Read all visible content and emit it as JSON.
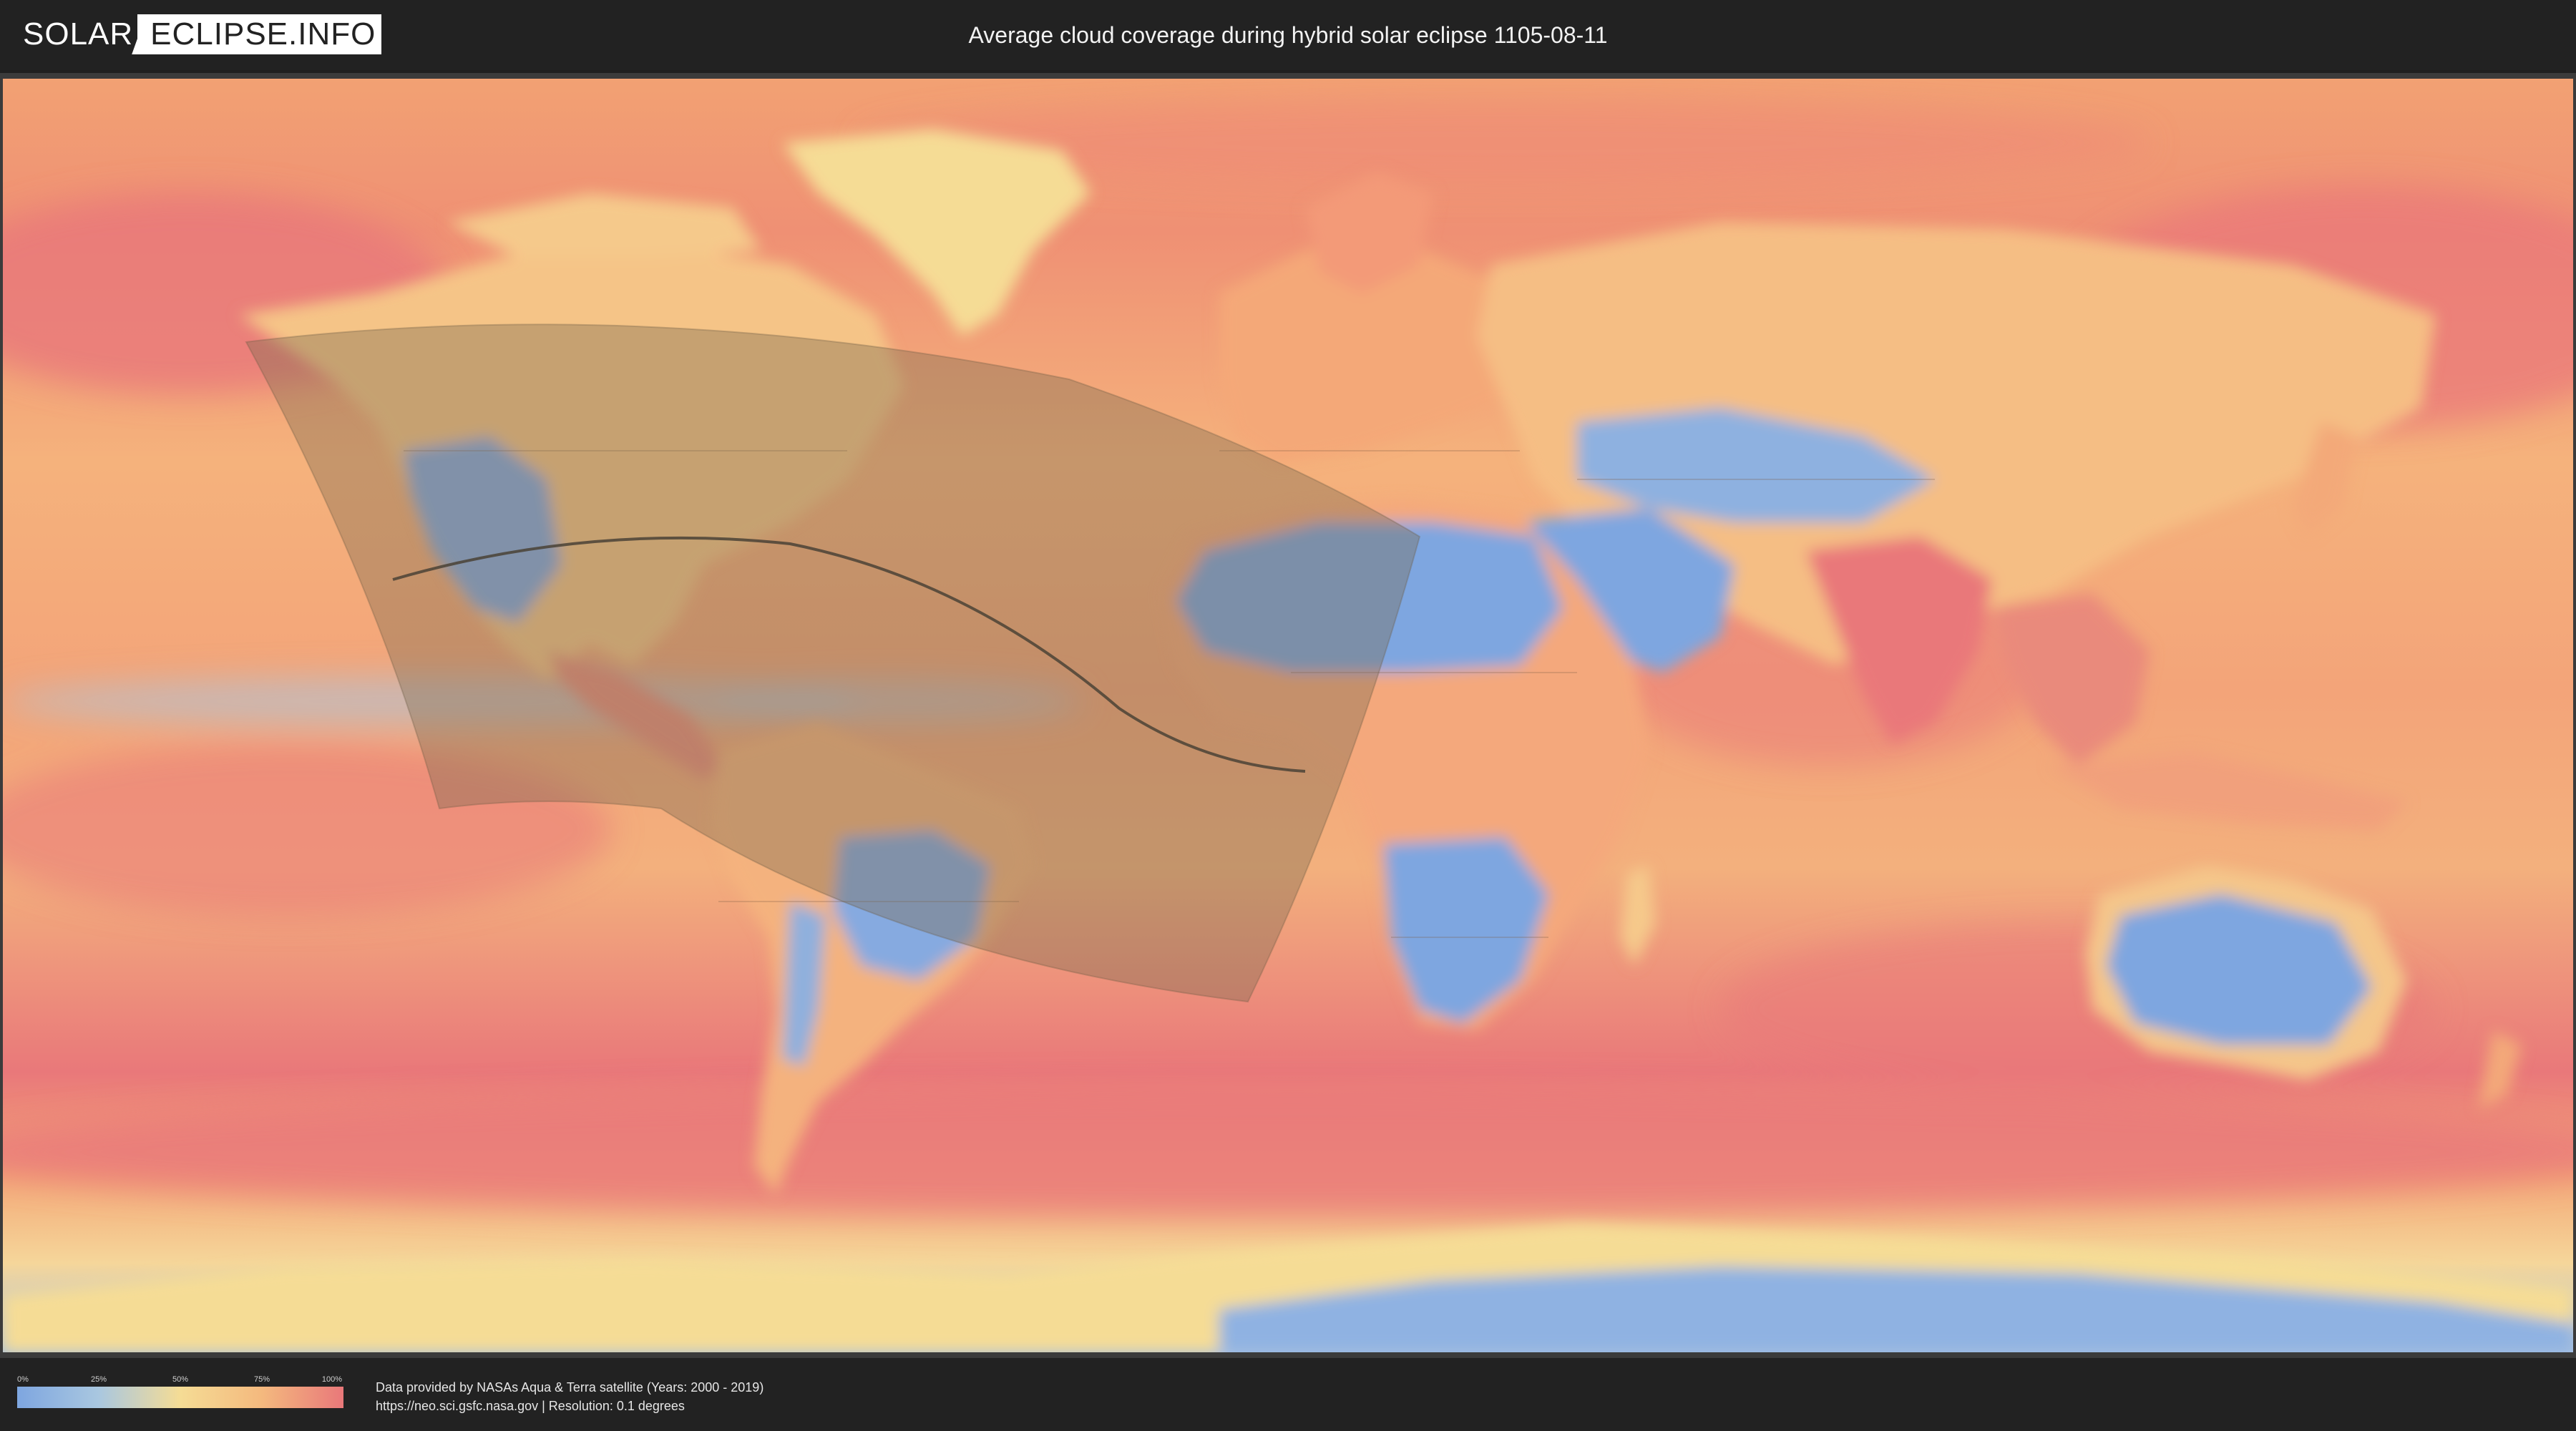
{
  "header": {
    "logo_left": "SOLAR",
    "logo_right": "ECLIPSE.INFO",
    "title": "Average cloud coverage during hybrid solar eclipse 1105-08-11"
  },
  "legend": {
    "ticks": [
      "0%",
      "25%",
      "50%",
      "75%",
      "100%"
    ],
    "colors": [
      "#7ea6e0",
      "#a9c7e0",
      "#f5dc95",
      "#f4b97e",
      "#e9787a"
    ]
  },
  "footer": {
    "credit_line1": "Data provided by NASAs Aqua & Terra satellite (Years: 2000 - 2019)",
    "credit_line2": "https://neo.sci.gsfc.nasa.gov | Resolution: 0.1 degrees"
  },
  "map": {
    "colors": {
      "ocean_cloudy": "#e9787a",
      "ocean_mid": "#f4b97e",
      "clear": "#7ea6e0",
      "partly": "#f5dc95",
      "eclipse_overlay": "#7a6a50"
    },
    "eclipse_path": {
      "type": "hybrid",
      "date": "1105-08-11"
    }
  }
}
